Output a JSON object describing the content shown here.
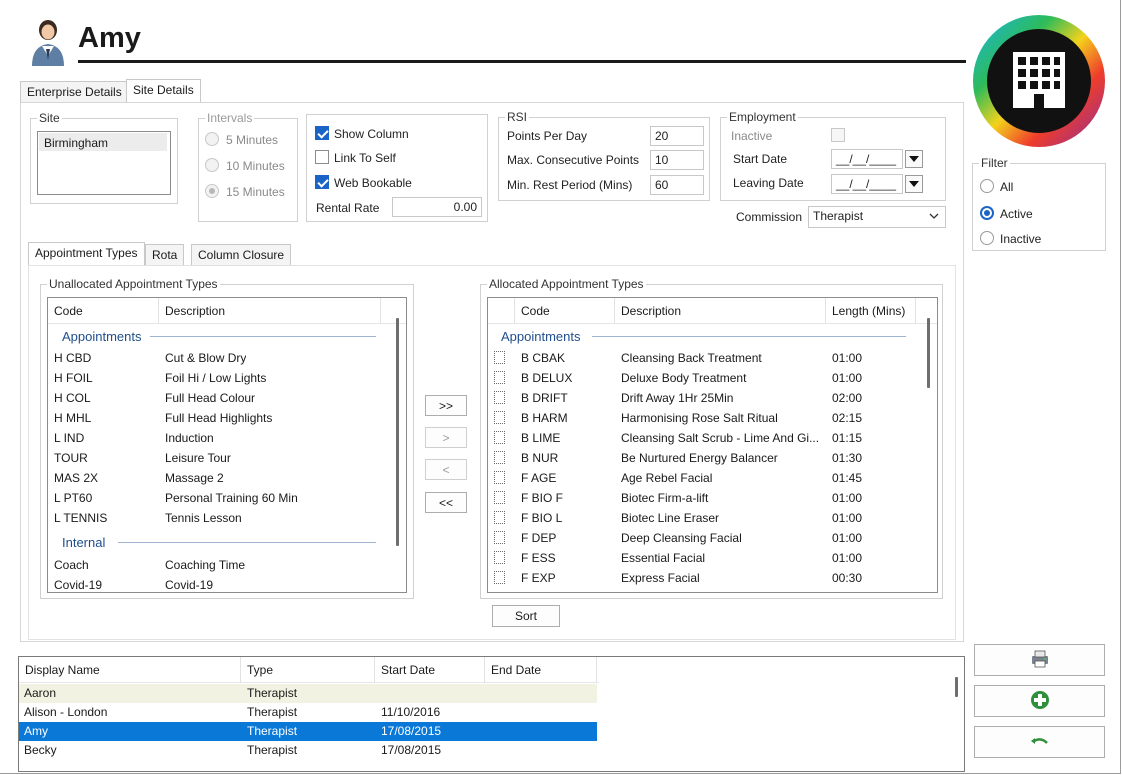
{
  "header": {
    "title": "Amy",
    "icons": {
      "user": "user-avatar-icon",
      "logo": "building-logo-icon"
    }
  },
  "outer_tabs": [
    "Enterprise Details",
    "Site Details"
  ],
  "site": {
    "legend": "Site",
    "items": [
      "Birmingham"
    ]
  },
  "intervals": {
    "legend": "Intervals",
    "options": [
      "5 Minutes",
      "10 Minutes",
      "15 Minutes"
    ],
    "selected": "15 Minutes"
  },
  "options": {
    "show_column": "Show Column",
    "link_to_self": "Link To Self",
    "web_bookable": "Web Bookable",
    "rental_rate_label": "Rental Rate",
    "rental_rate_value": "0.00"
  },
  "rsi": {
    "legend": "RSI",
    "points_per_day_label": "Points Per Day",
    "points_per_day": "20",
    "max_consecutive_label": "Max. Consecutive Points",
    "max_consecutive": "10",
    "min_rest_label": "Min. Rest Period (Mins)",
    "min_rest": "60"
  },
  "employment": {
    "legend": "Employment",
    "inactive_label": "Inactive",
    "start_date_label": "Start Date",
    "start_date": "__/__/____",
    "leaving_date_label": "Leaving Date",
    "leaving_date": "__/__/____",
    "commission_label": "Commission",
    "commission": "Therapist"
  },
  "filter": {
    "legend": "Filter",
    "options": [
      "All",
      "Active",
      "Inactive"
    ],
    "selected": "Active"
  },
  "inner_tabs": [
    "Appointment Types",
    "Rota",
    "Column Closure"
  ],
  "unallocated": {
    "legend": "Unallocated Appointment Types",
    "columns": [
      "Code",
      "Description"
    ],
    "groups": [
      {
        "title": "Appointments",
        "rows": [
          [
            "H CBD",
            "Cut & Blow Dry"
          ],
          [
            "H FOIL",
            "Foil Hi / Low Lights"
          ],
          [
            "H COL",
            "Full Head Colour"
          ],
          [
            "H MHL",
            "Full Head Highlights"
          ],
          [
            "L IND",
            "Induction"
          ],
          [
            "TOUR",
            "Leisure Tour"
          ],
          [
            "MAS 2X",
            "Massage 2"
          ],
          [
            "L PT60",
            "Personal Training 60 Min"
          ],
          [
            "L TENNIS",
            "Tennis Lesson"
          ]
        ]
      },
      {
        "title": "Internal",
        "rows": [
          [
            "Coach",
            "Coaching Time"
          ],
          [
            "Covid-19",
            "Covid-19"
          ]
        ]
      }
    ]
  },
  "transfer_buttons": [
    ">>",
    ">",
    "<",
    "<<"
  ],
  "allocated": {
    "legend": "Allocated Appointment Types",
    "columns": [
      "Code",
      "Description",
      "Length (Mins)"
    ],
    "group_title": "Appointments",
    "rows": [
      [
        "B CBAK",
        "Cleansing Back Treatment",
        "01:00"
      ],
      [
        "B DELUX",
        "Deluxe Body Treatment",
        "01:00"
      ],
      [
        "B DRIFT",
        "Drift Away 1Hr 25Min",
        "02:00"
      ],
      [
        "B HARM",
        "Harmonising Rose Salt Ritual",
        "02:15"
      ],
      [
        "B LIME",
        "Cleansing Salt Scrub - Lime And Gi...",
        "01:15"
      ],
      [
        "B NUR",
        "Be Nurtured Energy Balancer",
        "01:30"
      ],
      [
        "F AGE",
        "Age Rebel Facial",
        "01:45"
      ],
      [
        "F BIO F",
        "Biotec Firm-a-lift",
        "01:00"
      ],
      [
        "F BIO L",
        "Biotec Line Eraser",
        "01:00"
      ],
      [
        "F DEP",
        "Deep Cleansing Facial",
        "01:00"
      ],
      [
        "F ESS",
        "Essential Facial",
        "01:00"
      ],
      [
        "F EXP",
        "Express Facial",
        "00:30"
      ]
    ]
  },
  "sort_label": "Sort",
  "staff_grid": {
    "columns": [
      "Display Name",
      "Type",
      "Start Date",
      "End Date"
    ],
    "rows": [
      [
        "Aaron",
        "Therapist",
        "",
        ""
      ],
      [
        "Alison - London",
        "Therapist",
        "11/10/2016",
        ""
      ],
      [
        "Amy",
        "Therapist",
        "17/08/2015",
        ""
      ],
      [
        "Becky",
        "Therapist",
        "17/08/2015",
        ""
      ]
    ],
    "selected_index": 2,
    "highlight_index": 0
  },
  "side_buttons": [
    "printer-icon",
    "add-icon",
    "undo-icon"
  ],
  "colors": {
    "accent": "#0a78d7",
    "highlight_row": "#f2f2e2",
    "group_title": "#1f4e8c"
  }
}
